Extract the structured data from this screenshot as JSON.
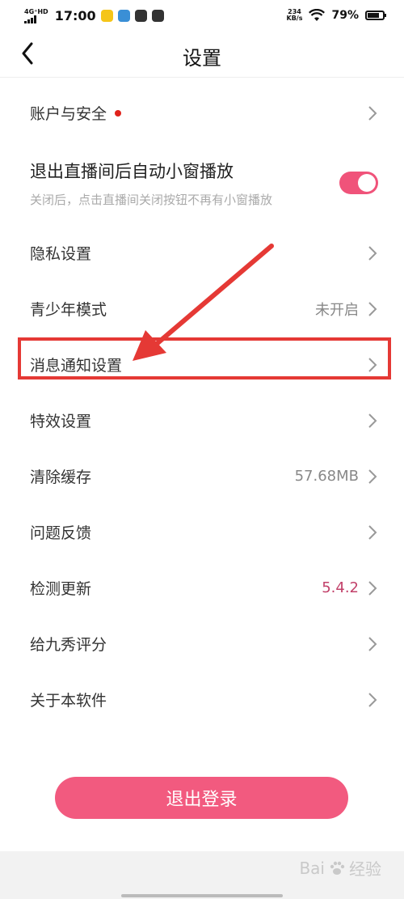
{
  "status_bar": {
    "network": "4G⁺HD",
    "time": "17:00",
    "net_speed_value": "234",
    "net_speed_unit": "KB/s",
    "battery_pct": "79%",
    "battery_level": 0.79
  },
  "header": {
    "title": "设置"
  },
  "settings": {
    "account": {
      "label": "账户与安全"
    },
    "auto_window": {
      "title": "退出直播间后自动小窗播放",
      "subtitle": "关闭后，点击直播间关闭按钮不再有小窗播放",
      "enabled": true
    },
    "privacy": {
      "label": "隐私设置"
    },
    "teen_mode": {
      "label": "青少年模式",
      "value": "未开启"
    },
    "notifications": {
      "label": "消息通知设置"
    },
    "effects": {
      "label": "特效设置"
    },
    "clear_cache": {
      "label": "清除缓存",
      "value": "57.68MB"
    },
    "feedback": {
      "label": "问题反馈"
    },
    "check_update": {
      "label": "检测更新",
      "value": "5.4.2"
    },
    "rate_app": {
      "label": "给九秀评分"
    },
    "about": {
      "label": "关于本软件"
    }
  },
  "logout": {
    "label": "退出登录"
  },
  "watermark": {
    "brand": "Bai",
    "suffix": "经验"
  },
  "colors": {
    "accent_pink": "#f25a7f",
    "annotation_red": "#e53935",
    "version_text": "#c2416a"
  }
}
